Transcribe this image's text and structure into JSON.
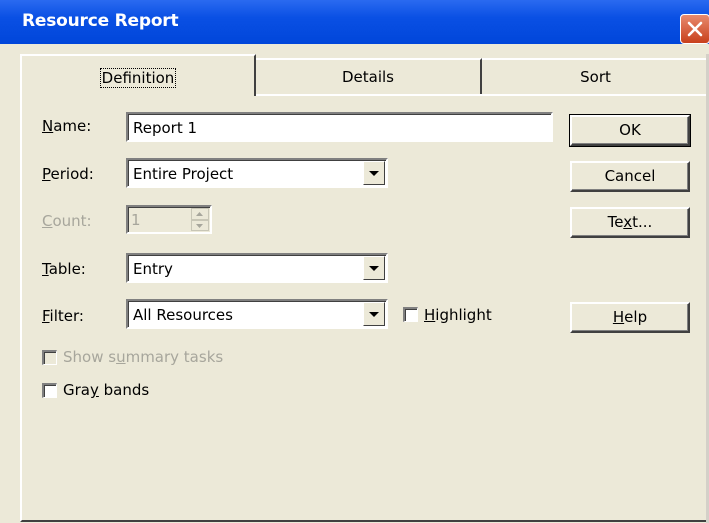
{
  "window": {
    "title": "Resource Report"
  },
  "tabs": [
    {
      "label": "Definition",
      "active": true
    },
    {
      "label": "Details",
      "active": false
    },
    {
      "label": "Sort",
      "active": false
    }
  ],
  "form": {
    "name": {
      "label_pre": "",
      "label_u": "N",
      "label_post": "ame:",
      "value": "Report 1"
    },
    "period": {
      "label_pre": "",
      "label_u": "P",
      "label_post": "eriod:",
      "value": "Entire Project"
    },
    "count": {
      "label_pre": "",
      "label_u": "C",
      "label_post": "ount:",
      "value": "1",
      "disabled": true
    },
    "table": {
      "label_pre": "",
      "label_u": "T",
      "label_post": "able:",
      "value": "Entry"
    },
    "filter": {
      "label_pre": "",
      "label_u": "F",
      "label_post": "ilter:",
      "value": "All Resources"
    },
    "highlight": {
      "label_pre": "",
      "label_u": "H",
      "label_post": "ighlight",
      "checked": false
    },
    "show_summary": {
      "label_pre": "Show s",
      "label_u": "u",
      "label_post": "mmary tasks",
      "checked": false,
      "disabled": true
    },
    "gray_bands": {
      "label_pre": "Gra",
      "label_u": "y",
      "label_post": " bands",
      "checked": false
    }
  },
  "buttons": {
    "ok": {
      "label": "OK"
    },
    "cancel": {
      "label": "Cancel"
    },
    "text": {
      "label_pre": "Te",
      "label_u": "x",
      "label_post": "t..."
    },
    "help": {
      "label_pre": "",
      "label_u": "H",
      "label_post": "elp"
    }
  },
  "colors": {
    "titlebar": "#0a50e4",
    "dialog_bg": "#ece9d8",
    "close": "#c8401c",
    "disabled_text": "#a7a69c"
  }
}
